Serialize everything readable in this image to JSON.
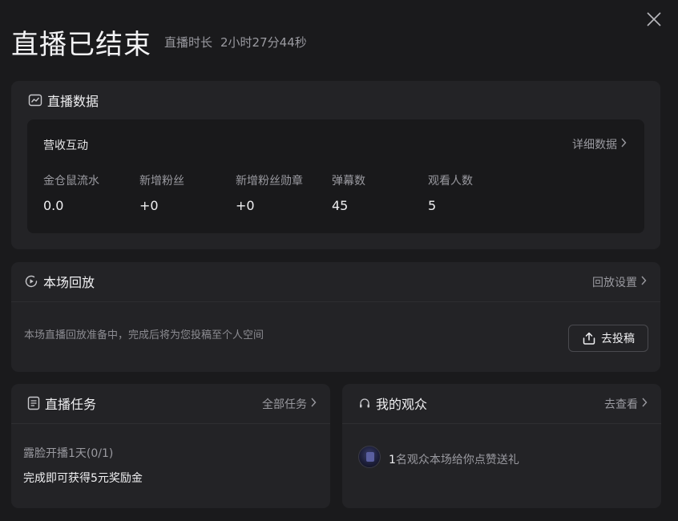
{
  "header": {
    "title": "直播已结束",
    "duration_label": "直播时长",
    "duration_value": "2小时27分44秒"
  },
  "live_data": {
    "title": "直播数据",
    "section_title": "营收互动",
    "detail_link": "详细数据",
    "stats": [
      {
        "label": "金仓鼠流水",
        "value": "0.0"
      },
      {
        "label": "新增粉丝",
        "value": "+0"
      },
      {
        "label": "新增粉丝勋章",
        "value": "+0"
      },
      {
        "label": "弹幕数",
        "value": "45"
      },
      {
        "label": "观看人数",
        "value": "5"
      }
    ]
  },
  "replay": {
    "title": "本场回放",
    "settings_link": "回放设置",
    "message": "本场直播回放准备中，完成后将为您投稿至个人空间",
    "submit_label": "去投稿"
  },
  "tasks": {
    "title": "直播任务",
    "all_link": "全部任务",
    "task_name": "露脸开播1天(0/1)",
    "task_desc": "完成即可获得5元奖励金"
  },
  "audience": {
    "title": "我的观众",
    "view_link": "去查看",
    "message_count": "1",
    "message_text": "名观众本场给你点赞送礼"
  },
  "icons": {
    "close": "close-icon",
    "chart": "chart-icon",
    "replay": "play-circle-icon",
    "tasks": "document-icon",
    "audience": "headset-icon",
    "upload": "upload-icon"
  },
  "colors": {
    "background": "#1a1a1c",
    "card": "#232326",
    "inner": "#19191b",
    "muted_text": "#9a9aa0"
  }
}
